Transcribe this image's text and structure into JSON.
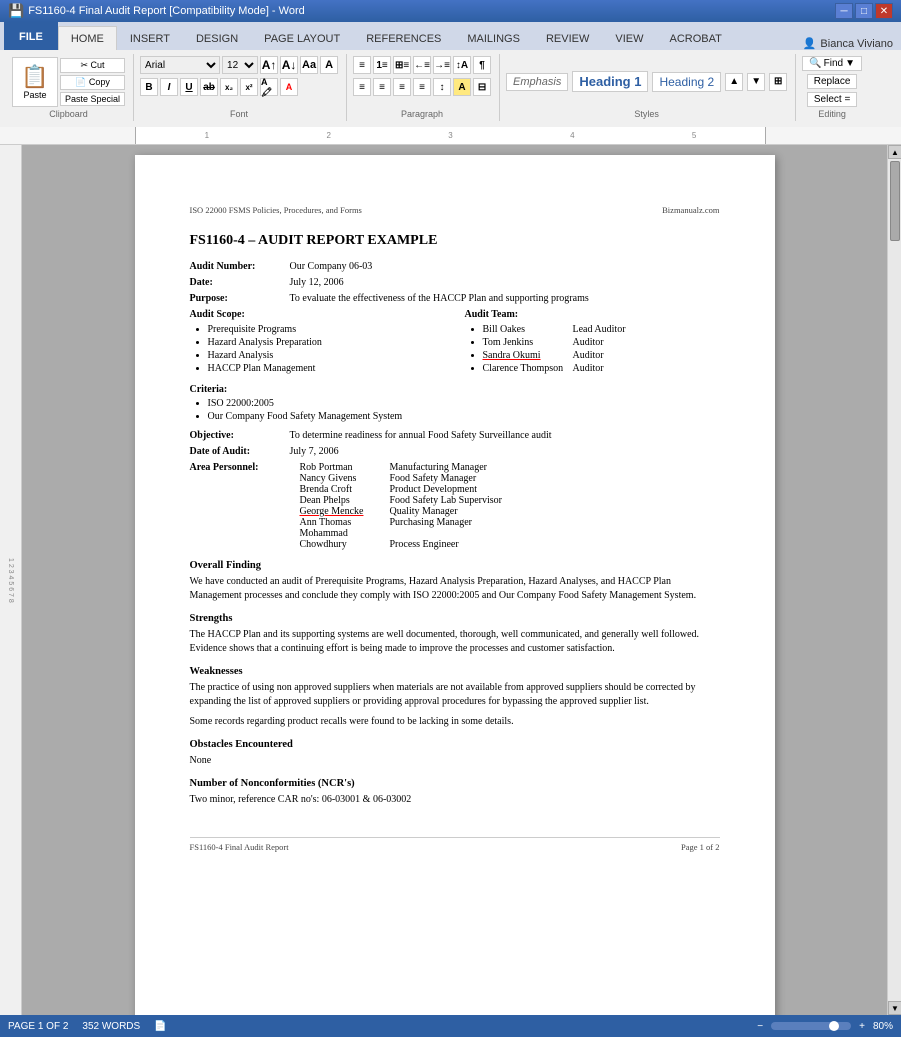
{
  "titleBar": {
    "title": "FS1160-4 Final Audit Report [Compatibility Mode] - Word",
    "minBtn": "─",
    "restoreBtn": "□",
    "closeBtn": "✕"
  },
  "ribbon": {
    "tabs": [
      "FILE",
      "HOME",
      "INSERT",
      "DESIGN",
      "PAGE LAYOUT",
      "REFERENCES",
      "MAILINGS",
      "REVIEW",
      "VIEW",
      "ACROBAT"
    ],
    "activeTab": "HOME",
    "clipboard": {
      "paste": "Paste",
      "cutLabel": "Cut",
      "copyLabel": "Copy",
      "pasteSpecialLabel": "Paste Special"
    },
    "font": {
      "fontName": "Arial",
      "fontSize": "12",
      "bold": "B",
      "italic": "I",
      "underline": "U",
      "strikethrough": "ab",
      "subscript": "x₂",
      "superscript": "x²"
    },
    "styles": {
      "emphasis": "Emphasis",
      "heading1": "Heading 1",
      "heading2": "Heading 2"
    },
    "editing": {
      "find": "Find",
      "replace": "Replace",
      "select": "Select ="
    },
    "user": "Bianca Viviano"
  },
  "document": {
    "headerLeft": "ISO 22000 FSMS Policies, Procedures, and Forms",
    "headerRight": "Bizmanualz.com",
    "title": "FS1160-4 – AUDIT REPORT EXAMPLE",
    "auditNumber": {
      "label": "Audit Number:",
      "value": "Our Company 06-03"
    },
    "date": {
      "label": "Date:",
      "value": "July 12, 2006"
    },
    "purpose": {
      "label": "Purpose:",
      "value": "To evaluate the effectiveness of the HACCP Plan and supporting programs"
    },
    "auditScope": {
      "label": "Audit Scope:",
      "items": [
        "Prerequisite Programs",
        "Hazard Analysis Preparation",
        "Hazard Analysis",
        "HACCP Plan Management"
      ]
    },
    "auditTeam": {
      "label": "Audit Team:",
      "members": [
        {
          "name": "Bill Oakes",
          "role": "Lead Auditor"
        },
        {
          "name": "Tom Jenkins",
          "role": "Auditor"
        },
        {
          "name": "Sandra Okumi",
          "role": "Auditor"
        },
        {
          "name": "Clarence Thompson",
          "role": "Auditor"
        }
      ]
    },
    "criteria": {
      "label": "Criteria:",
      "items": [
        "ISO 22000:2005",
        "Our Company Food Safety Management System"
      ]
    },
    "objective": {
      "label": "Objective:",
      "value": "To determine readiness for annual Food Safety Surveillance audit"
    },
    "dateOfAudit": {
      "label": "Date of Audit:",
      "value": "July 7, 2006"
    },
    "areaPersonnel": {
      "label": "Area Personnel:",
      "rows": [
        {
          "name": "Rob Portman",
          "title": "Manufacturing Manager"
        },
        {
          "name": "Nancy Givens",
          "title": "Food Safety Manager"
        },
        {
          "name": "Brenda Croft",
          "title": "Product Development"
        },
        {
          "name": "Dean Phelps",
          "title": "Food Safety Lab Supervisor"
        },
        {
          "name": "George Mencke",
          "title": "Quality Manager"
        },
        {
          "name": "Ann Thomas",
          "title": "Purchasing Manager"
        },
        {
          "name": "Mohammad",
          "title": ""
        },
        {
          "name": "Chowdhury",
          "title": "Process Engineer"
        }
      ]
    },
    "overallFinding": {
      "heading": "Overall Finding",
      "text": "We have conducted an audit of Prerequisite Programs, Hazard Analysis Preparation, Hazard Analyses, and HACCP Plan Management processes and conclude they comply with ISO 22000:2005 and Our Company Food Safety Management System."
    },
    "strengths": {
      "heading": "Strengths",
      "text": "The HACCP Plan and its supporting systems are well documented, thorough, well communicated, and generally well followed. Evidence shows that a continuing effort is being made to improve the processes and customer satisfaction."
    },
    "weaknesses": {
      "heading": "Weaknesses",
      "text1": "The practice of using non approved suppliers when materials are not available from approved suppliers should be corrected by expanding the list of approved suppliers or providing approval procedures for bypassing the approved supplier list.",
      "text2": "Some records regarding product recalls were found to be lacking in some details."
    },
    "obstacles": {
      "heading": "Obstacles Encountered",
      "text": "None"
    },
    "ncr": {
      "heading": "Number of Nonconformities (NCR's)",
      "text": "Two minor, reference CAR no's: 06-03001 & 06-03002"
    },
    "footerLeft": "FS1160-4 Final Audit Report",
    "footerRight": "Page 1 of 2"
  },
  "statusBar": {
    "page": "PAGE 1 OF 2",
    "words": "352 WORDS",
    "zoom": "80%"
  }
}
